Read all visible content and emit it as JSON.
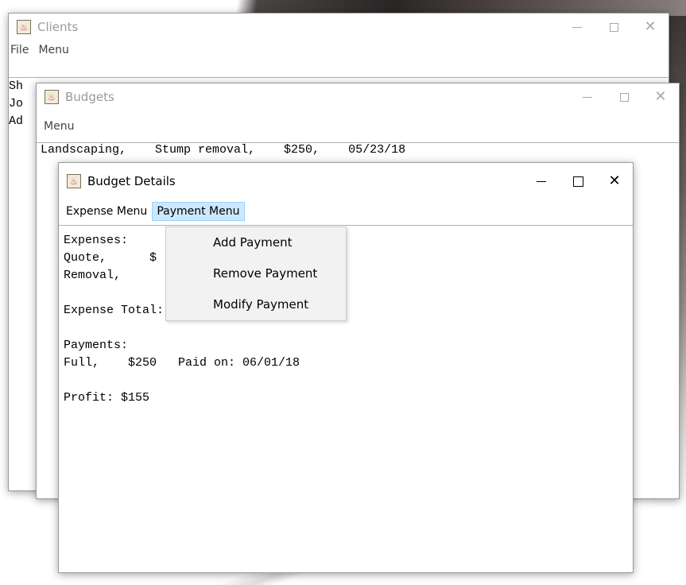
{
  "clients_window": {
    "title": "Clients",
    "menus": [
      "File",
      "Menu"
    ],
    "lines": [
      "Sh",
      "Jo",
      "Ad"
    ]
  },
  "budgets_window": {
    "title": "Budgets",
    "menus": [
      "Menu"
    ],
    "lines": [
      "Landscaping,    Stump removal,    $250,    05/23/18"
    ]
  },
  "details_window": {
    "title": "Budget Details",
    "menus": [
      "Expense Menu",
      "Payment Menu"
    ],
    "lines": [
      "Expenses:",
      "Quote,      $",
      "Removal,",
      "",
      "Expense Total:  $95",
      "",
      "Payments:",
      "Full,    $250   Paid on: 06/01/18",
      "",
      "Profit: $155"
    ]
  },
  "payment_dropdown": {
    "items": [
      "Add Payment",
      "Remove Payment",
      "Modify Payment"
    ]
  },
  "icons": {
    "app": "java-app-icon",
    "minimize": "minimize-icon",
    "maximize": "maximize-icon",
    "close": "close-icon"
  }
}
